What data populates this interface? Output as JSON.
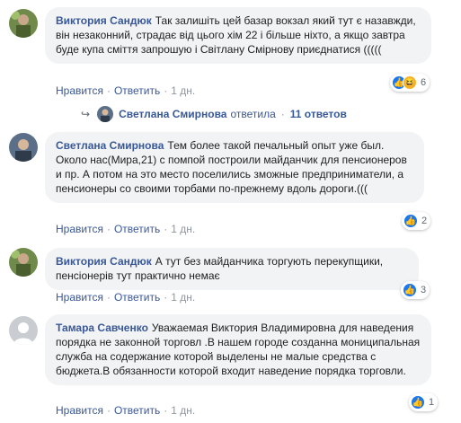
{
  "comments": [
    {
      "author": "Виктория Сандюк",
      "text": "Так залишіть цей базар вокзал який тут є назавжди, він незаконний, страдає від цього хім 22 і більше ніхто, а якщо завтра буде купа сміття запрошую і Світлану Смірнову приєднатися (((((",
      "like_label": "Нравится",
      "reply_label": "Ответить",
      "time": "1 дн.",
      "reaction_count": "6"
    },
    {
      "author": "Светлана Смирнова",
      "text": "Тем более такой печальный опыт уже был. Около нас(Мира,21) с помпой построили майданчик для пенсионеров и пр. А потом на это место поселились зможные предприниматели, а пенсионеры со своими торбами по-прежнему вдоль дороги.(((",
      "like_label": "Нравится",
      "reply_label": "Ответить",
      "time": "1 дн.",
      "reaction_count": "2"
    },
    {
      "author": "Виктория Сандюк",
      "text": "А тут без майданчика торгують перекупщики, пенсіонерів тут практично немає",
      "like_label": "Нравится",
      "reply_label": "Ответить",
      "time": "1 дн.",
      "reaction_count": "3"
    },
    {
      "author": "Тамара Савченко",
      "text": "Уважаемая Виктория Владимировна для наведения порядка не законной торговл .В нашем городе созданна мониципальная служба на содержание которой выделены не малые средства с бюджета.В обязанности которой входит наведение порядка торговли.",
      "like_label": "Нравится",
      "reply_label": "Ответить",
      "time": "1 дн.",
      "reaction_count": "1"
    }
  ],
  "replies_row": {
    "name": "Светлана Смирнова",
    "verb": "ответила",
    "count": "11 ответов"
  },
  "colors": {
    "link": "#385898",
    "bubble": "#f2f3f5",
    "like": "#1877f2",
    "haha": "#f7b125"
  },
  "icons": {
    "reply_arrow": "reply-arrow-icon",
    "like": "like-icon",
    "haha": "haha-icon"
  }
}
